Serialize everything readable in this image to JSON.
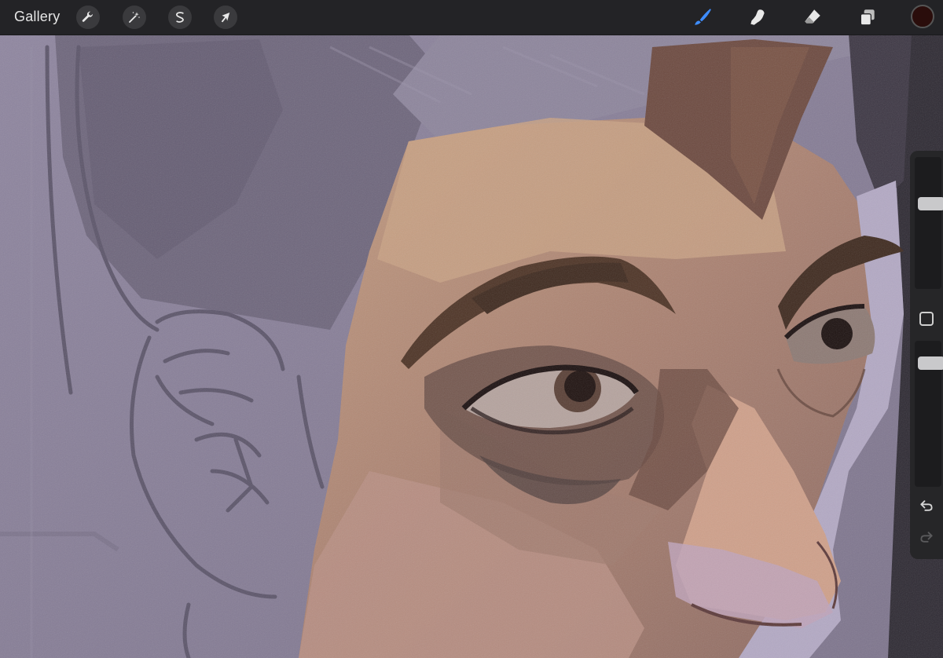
{
  "toolbar": {
    "gallery_label": "Gallery",
    "left_tools": [
      {
        "name": "actions",
        "icon": "wrench-icon"
      },
      {
        "name": "adjustments",
        "icon": "magic-wand-icon"
      },
      {
        "name": "selection",
        "icon": "selection-s-icon"
      },
      {
        "name": "transform",
        "icon": "arrow-cursor-icon"
      }
    ],
    "right_tools": [
      {
        "name": "brush",
        "icon": "brush-icon",
        "active": true
      },
      {
        "name": "smudge",
        "icon": "smudge-finger-icon",
        "active": false
      },
      {
        "name": "eraser",
        "icon": "eraser-icon",
        "active": false
      },
      {
        "name": "layers",
        "icon": "layers-icon",
        "active": false
      }
    ],
    "current_color": "#2a0d0b"
  },
  "sidebar": {
    "brush_size_level": 0.32,
    "opacity_level": 0.08,
    "modify_icon": "square-outline-icon",
    "undo_icon": "undo-arrow-icon",
    "redo_icon": "redo-arrow-icon"
  },
  "colors": {
    "accent": "#3e8dff",
    "toolbar_bg": "#232326",
    "sidebar_bg": "#262628",
    "canvas_bg": "#8a8196"
  }
}
